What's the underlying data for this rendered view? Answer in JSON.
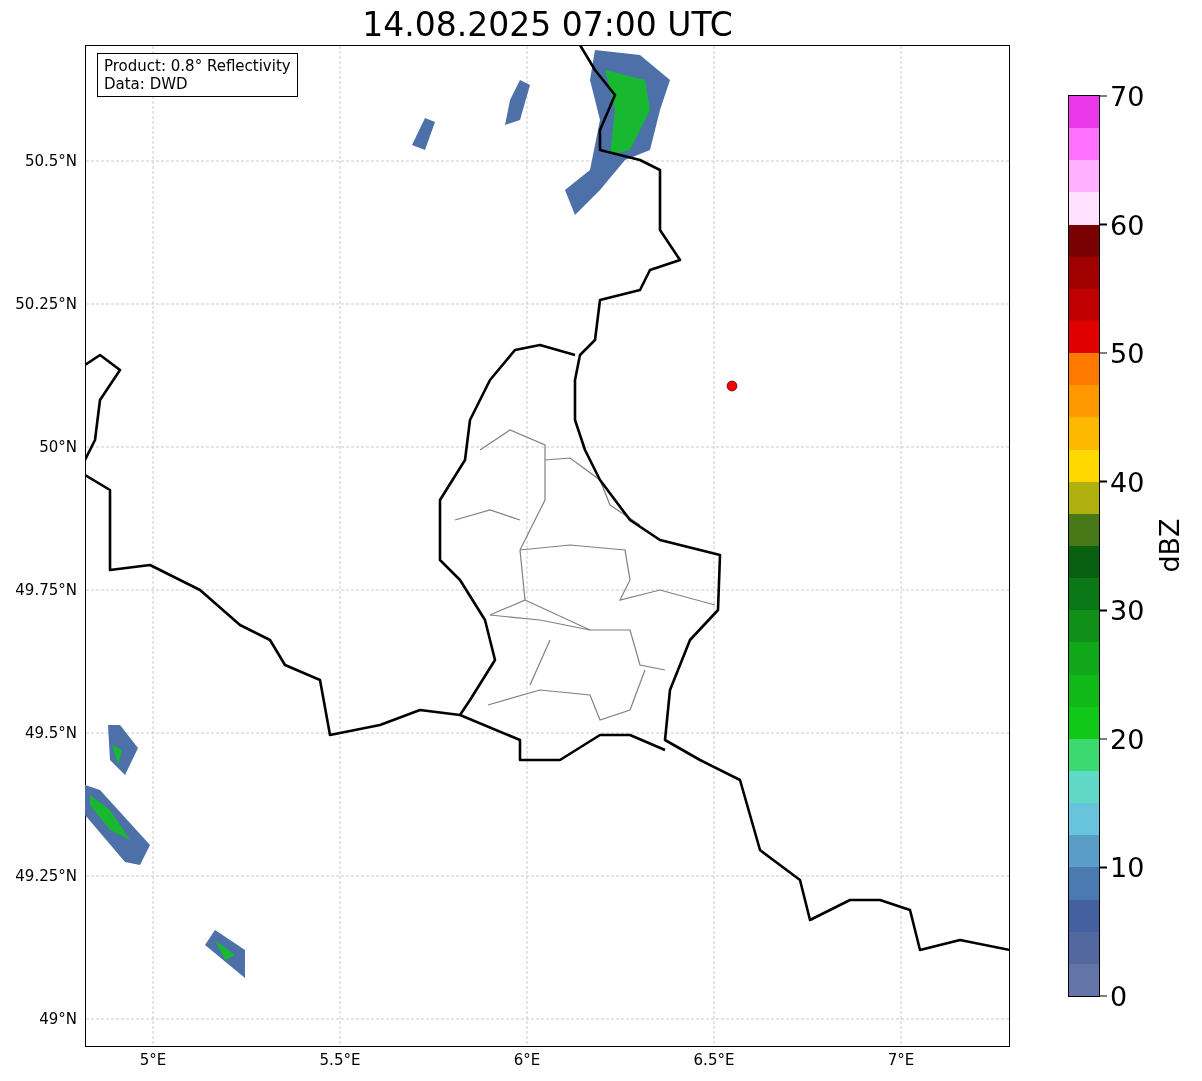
{
  "title": "14.08.2025 07:00 UTC",
  "info_box": [
    "Product: 0.8° Reflectivity",
    "Data: DWD"
  ],
  "map": {
    "lat_ticks": [
      "50.5°N",
      "50.25°N",
      "50°N",
      "49.75°N",
      "49.5°N",
      "49.25°N",
      "49°N"
    ],
    "lon_ticks": [
      "5°E",
      "5.5°E",
      "6°E",
      "6.5°E",
      "7°E"
    ],
    "marker": {
      "color": "#ff0000"
    }
  },
  "colorbar": {
    "label": "dBZ",
    "ticks": [
      "70",
      "60",
      "50",
      "40",
      "30",
      "20",
      "10",
      "0"
    ],
    "bins": [
      {
        "color": "#6374a8"
      },
      {
        "color": "#5468a0"
      },
      {
        "color": "#4560a0"
      },
      {
        "color": "#4a7ab0"
      },
      {
        "color": "#5a9ec8"
      },
      {
        "color": "#68c4dc"
      },
      {
        "color": "#60d8c8"
      },
      {
        "color": "#3cd870"
      },
      {
        "color": "#10c818"
      },
      {
        "color": "#10b818"
      },
      {
        "color": "#10a818"
      },
      {
        "color": "#109018"
      },
      {
        "color": "#0b7818"
      },
      {
        "color": "#086010"
      },
      {
        "color": "#487818"
      },
      {
        "color": "#b0b010"
      },
      {
        "color": "#ffd800"
      },
      {
        "color": "#ffb800"
      },
      {
        "color": "#ff9800"
      },
      {
        "color": "#ff7800"
      },
      {
        "color": "#e00000"
      },
      {
        "color": "#c00000"
      },
      {
        "color": "#a00000"
      },
      {
        "color": "#780000"
      },
      {
        "color": "#ffe0ff"
      },
      {
        "color": "#ffb0ff"
      },
      {
        "color": "#ff70ff"
      },
      {
        "color": "#e838e8"
      }
    ]
  }
}
